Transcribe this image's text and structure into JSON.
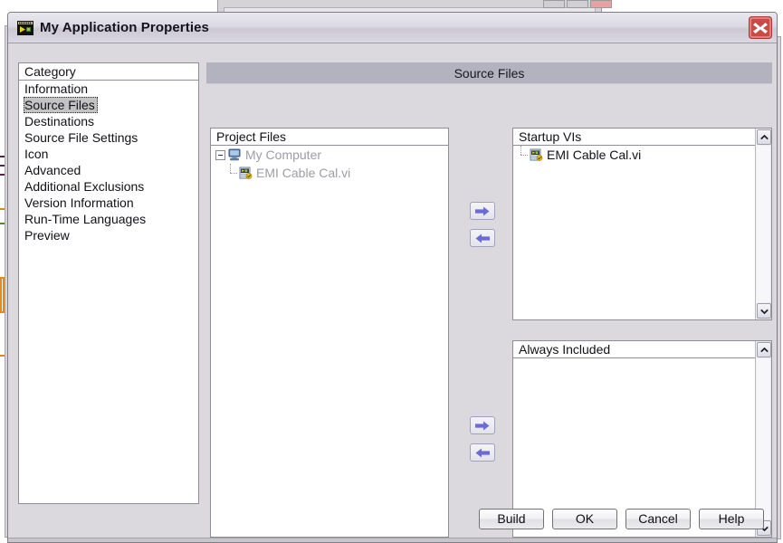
{
  "window": {
    "title": "My Application Properties",
    "icon": "labview-vi-icon",
    "close_label": "Close"
  },
  "category_panel": {
    "header": "Category",
    "selected": "Source Files",
    "items": [
      {
        "label": "Information"
      },
      {
        "label": "Source Files"
      },
      {
        "label": "Destinations"
      },
      {
        "label": "Source File Settings"
      },
      {
        "label": "Icon"
      },
      {
        "label": "Advanced"
      },
      {
        "label": "Additional Exclusions"
      },
      {
        "label": "Version Information"
      },
      {
        "label": "Run-Time Languages"
      },
      {
        "label": "Preview"
      }
    ]
  },
  "content": {
    "banner_title": "Source Files"
  },
  "project_files": {
    "header": "Project Files",
    "root": {
      "label": "My Computer",
      "icon": "computer-icon",
      "expanded": true,
      "disabled": true
    },
    "children": [
      {
        "label": "EMI Cable Cal.vi",
        "icon": "vi-file-icon",
        "disabled": true
      }
    ]
  },
  "startup_vis": {
    "header": "Startup VIs",
    "items": [
      {
        "label": "EMI Cable Cal.vi",
        "icon": "vi-file-icon"
      }
    ]
  },
  "always_included": {
    "header": "Always Included",
    "items": []
  },
  "transfer_buttons": {
    "startup_add": "add-to-startup-vis",
    "startup_remove": "remove-from-startup-vis",
    "always_add": "add-to-always-included",
    "always_remove": "remove-from-always-included"
  },
  "footer": {
    "buttons": [
      {
        "label": "Build"
      },
      {
        "label": "OK"
      },
      {
        "label": "Cancel"
      },
      {
        "label": "Help"
      }
    ]
  },
  "colors": {
    "dialog_bg": "#dbd9dd",
    "banner_bg": "#b3b3bf",
    "selection_bg": "#c3c3c3",
    "arrow_accent": "#6b6bd6",
    "close_red": "#d4564f",
    "disabled_text": "#9d9da5"
  }
}
